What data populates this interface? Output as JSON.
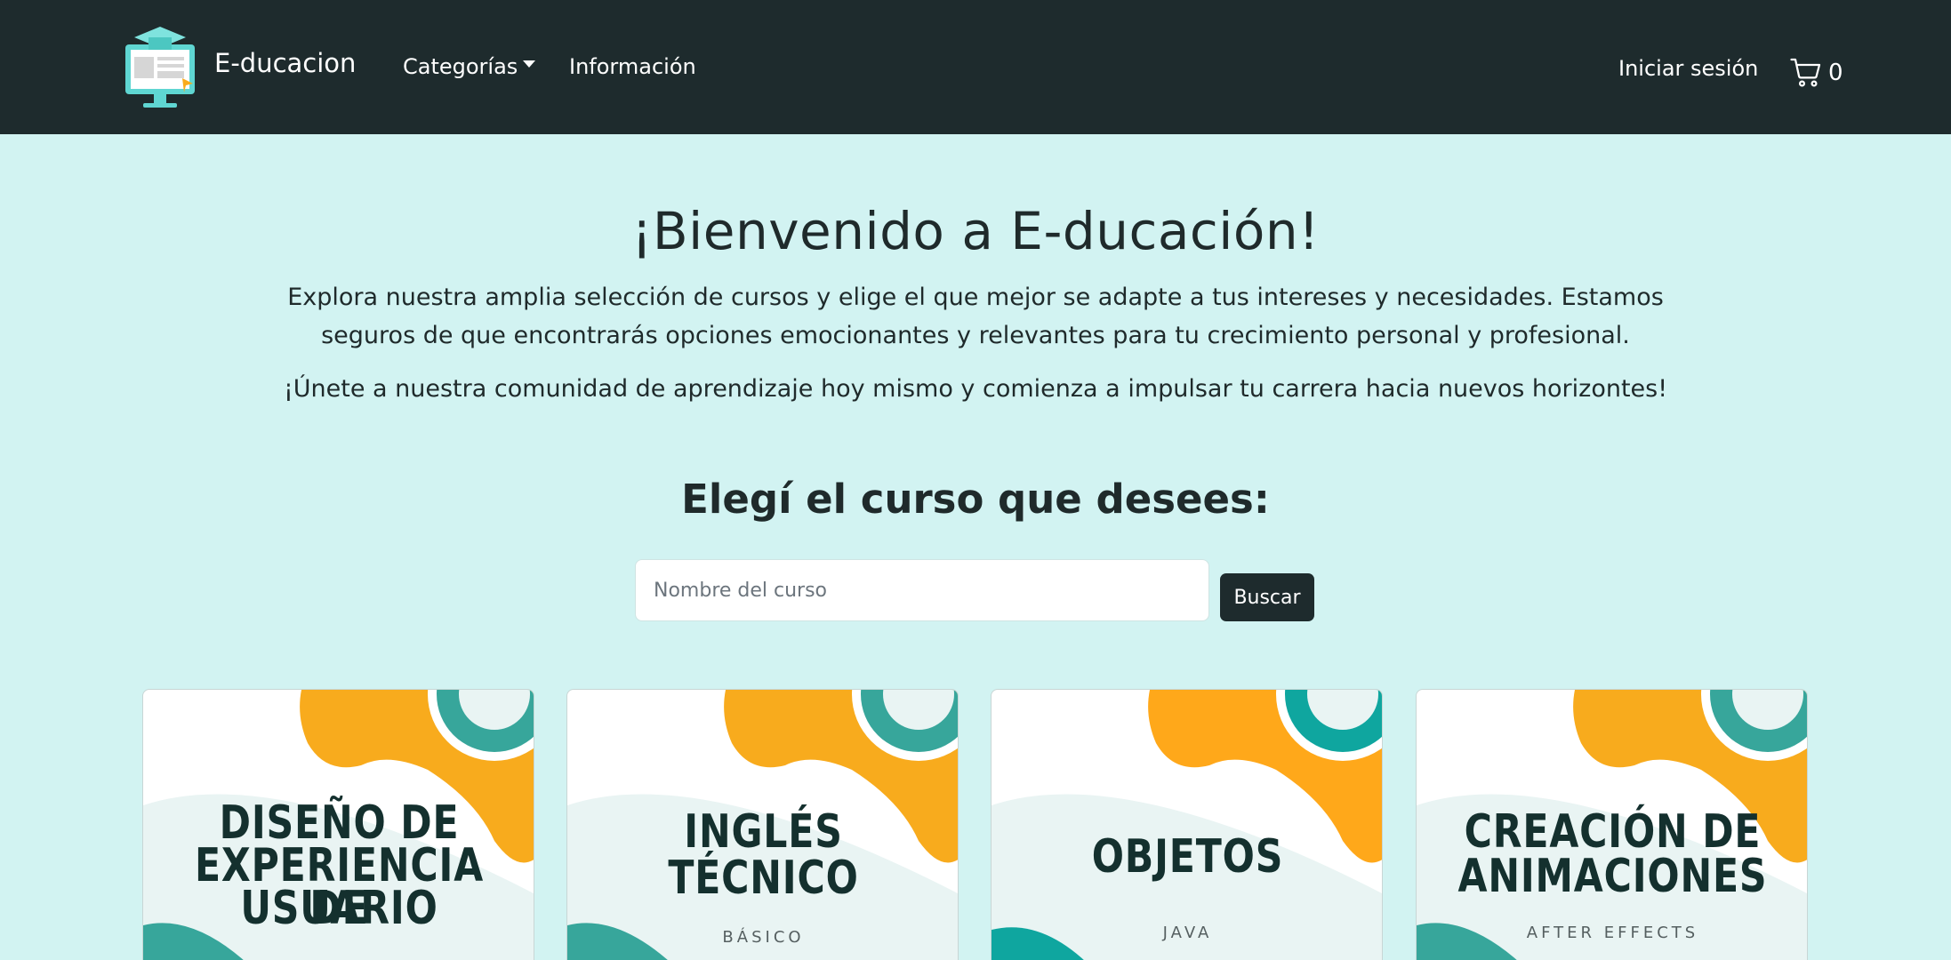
{
  "navbar": {
    "brand": "E-ducacion",
    "links": [
      {
        "label": "Categorías"
      },
      {
        "label": "Información"
      }
    ],
    "login": "Iniciar sesión",
    "cart_count": "0"
  },
  "hero": {
    "title": "¡Bienvenido a E-ducación!",
    "paragraph1": "Explora nuestra amplia selección de cursos y elige el que mejor se adapte a tus intereses y necesidades. Estamos seguros de que encontrarás opciones emocionantes y relevantes para tu crecimiento personal y profesional.",
    "paragraph2": "¡Únete a nuestra comunidad de aprendizaje hoy mismo y comienza a impulsar tu carrera hacia nuevos horizontes!"
  },
  "courses_section": {
    "title": "Elegí el curso que desees:",
    "search_placeholder": "Nombre del curso",
    "search_button": "Buscar"
  },
  "courses": [
    {
      "line1": "DISEÑO DE",
      "line2": "EXPERIENCIA DE",
      "line3": "USUARIO",
      "subtitle": ""
    },
    {
      "line1": "INGLÉS",
      "line2": "TÉCNICO",
      "line3": "",
      "subtitle": "BÁSICO"
    },
    {
      "line1": "OBJETOS",
      "line2": "",
      "line3": "",
      "subtitle": "JAVA"
    },
    {
      "line1": "CREACIÓN DE",
      "line2": "ANIMACIONES",
      "line3": "",
      "subtitle": "AFTER EFFECTS"
    }
  ],
  "colors": {
    "navbar": "#1e2b2d",
    "page_background": "#d2f3f2",
    "accent_orange": "#f8ab1d",
    "accent_teal": "#37a69b"
  }
}
